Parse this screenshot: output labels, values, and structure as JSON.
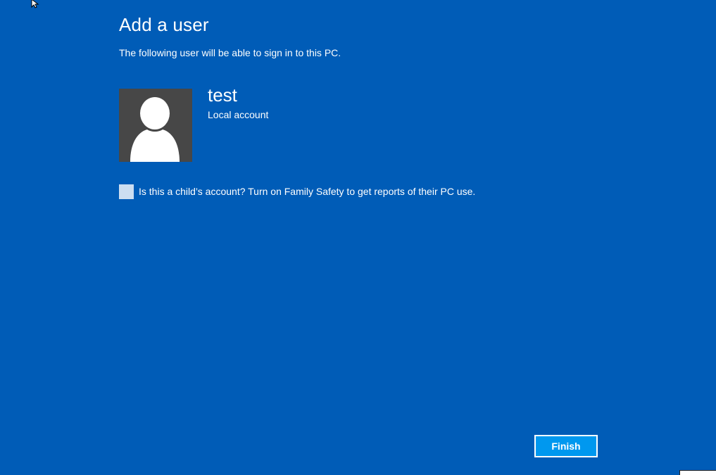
{
  "header": {
    "title": "Add a user",
    "subtitle": "The following user will be able to sign in to this PC."
  },
  "user": {
    "name": "test",
    "account_type": "Local account",
    "avatar_icon": "user-silhouette-icon"
  },
  "family_safety": {
    "label": "Is this a child’s account? Turn on Family Safety to get reports of their PC use.",
    "checked": false
  },
  "footer": {
    "finish_label": "Finish"
  },
  "colors": {
    "background": "#005cb7",
    "avatar_background": "#474747",
    "button_background": "#0098ef",
    "checkbox_fill": "#ccdef1"
  }
}
